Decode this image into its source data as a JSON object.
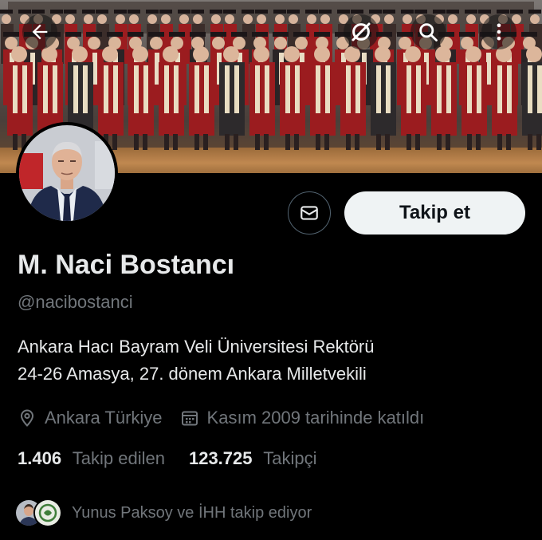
{
  "header": {
    "back_icon": "arrow-left-icon",
    "grok_icon": "grok-icon",
    "search_icon": "search-icon",
    "more_icon": "more-vertical-icon"
  },
  "profile": {
    "name": "M. Naci Bostancı",
    "handle": "@nacibostanci",
    "bio_line_1": "Ankara Hacı Bayram Veli Üniversitesi Rektörü",
    "bio_line_2": "24-26 Amasya, 27. dönem Ankara Milletvekili",
    "location": "Ankara Türkiye",
    "joined": "Kasım 2009 tarihinde katıldı",
    "following_count": "1.406",
    "following_label": "Takip edilen",
    "followers_count": "123.725",
    "followers_label": "Takipçi",
    "followed_by": "Yunus Paksoy ve İHH takip ediyor"
  },
  "actions": {
    "message_icon": "envelope-icon",
    "follow_label": "Takip et"
  },
  "colors": {
    "background": "#000000",
    "primary_text": "#e7e9ea",
    "secondary_text": "#71767b",
    "follow_button_bg": "#eff3f4",
    "robe_red": "#9b1c1f"
  }
}
